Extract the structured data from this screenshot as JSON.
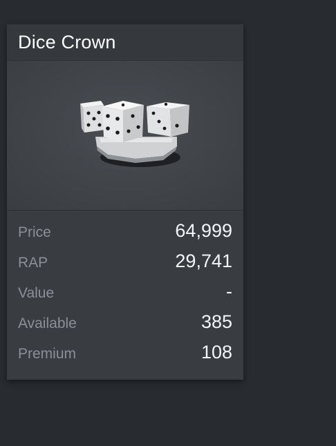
{
  "item": {
    "name": "Dice Crown",
    "image_icon": "dice-crown-icon"
  },
  "stats": [
    {
      "label": "Price",
      "value": "64,999"
    },
    {
      "label": "RAP",
      "value": "29,741"
    },
    {
      "label": "Value",
      "value": "-"
    },
    {
      "label": "Available",
      "value": "385"
    },
    {
      "label": "Premium",
      "value": "108"
    }
  ],
  "colors": {
    "background": "#282b30",
    "card": "#393c41",
    "label": "#8c9096",
    "value": "#f4f5f6"
  }
}
